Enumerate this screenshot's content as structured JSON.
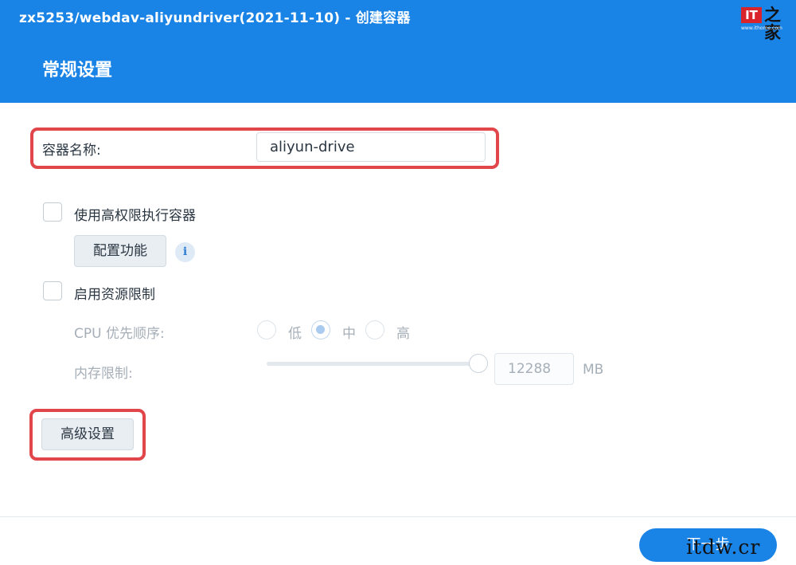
{
  "window": {
    "title": "zx5253/webdav-aliyundriver(2021-11-10) - 创建容器",
    "section_title": "常规设置",
    "logo": {
      "mark": "IT",
      "glyph": "之家",
      "url": "www.ithome.com"
    }
  },
  "form": {
    "container_name_label": "容器名称:",
    "container_name_value": "aliyun-drive",
    "privileged_label": "使用高权限执行容器",
    "privileged_checked": false,
    "config_button_label": "配置功能",
    "info_icon_glyph": "i",
    "resource_limit_label": "启用资源限制",
    "resource_limit_checked": false,
    "cpu_priority_label": "CPU 优先顺序:",
    "cpu_options": [
      "低",
      "中",
      "高"
    ],
    "cpu_selected": "中",
    "memory_label": "内存限制:",
    "memory_value": "12288",
    "memory_unit": "MB",
    "memory_slider_fraction": 1.0,
    "advanced_button_label": "高级设置"
  },
  "footer": {
    "next_button_label": "下一步",
    "watermark": "itdw.cr"
  },
  "colors": {
    "header_blue": "#1a83e6",
    "highlight_red": "#e0464a"
  }
}
